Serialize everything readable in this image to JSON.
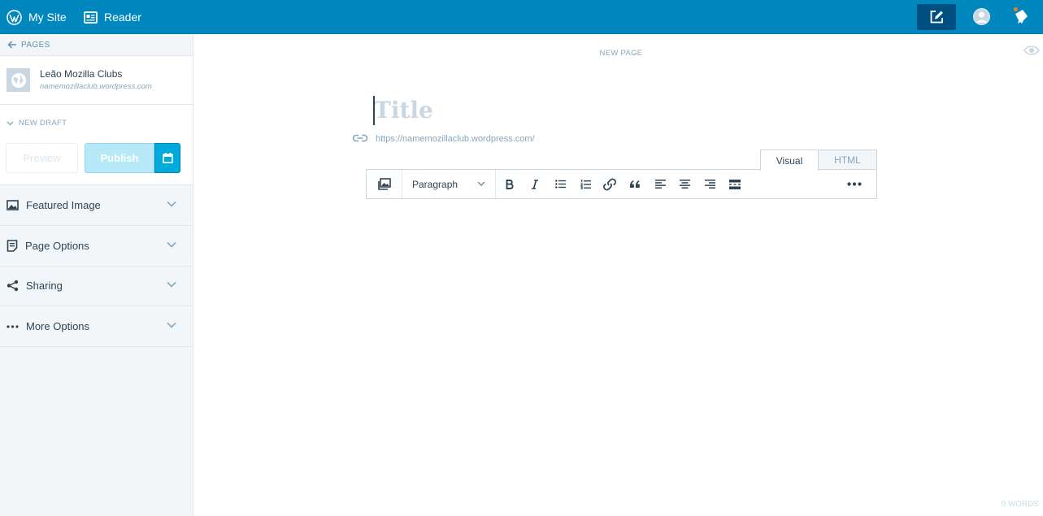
{
  "masterbar": {
    "my_site": "My Site",
    "reader": "Reader",
    "write_icon": "write-icon",
    "avatar_icon": "avatar-icon",
    "notifications_icon": "bell-icon",
    "background": "#0087be"
  },
  "sidebar": {
    "back_label": "PAGES",
    "site": {
      "name": "Leão Mozilla Clubs",
      "url": "namemozillaclub.wordpress.com"
    },
    "status_label": "NEW DRAFT",
    "preview_label": "Preview",
    "publish_label": "Publish",
    "sections": [
      {
        "label": "Featured Image",
        "icon": "image-icon"
      },
      {
        "label": "Page Options",
        "icon": "page-icon"
      },
      {
        "label": "Sharing",
        "icon": "share-icon"
      },
      {
        "label": "More Options",
        "icon": "ellipsis-icon"
      }
    ]
  },
  "editor": {
    "header_label": "NEW PAGE",
    "title_placeholder": "Title",
    "permalink": "https://namemozillaclub.wordpress.com/",
    "tabs": {
      "visual": "Visual",
      "html": "HTML"
    },
    "format_select": "Paragraph",
    "toolbar_buttons": [
      "bold-icon",
      "italic-icon",
      "bullet-list-icon",
      "numbered-list-icon",
      "link-icon",
      "quote-icon",
      "align-left-icon",
      "align-center-icon",
      "align-right-icon",
      "read-more-icon",
      "more-icon"
    ],
    "word_count": "0 WORDS"
  }
}
